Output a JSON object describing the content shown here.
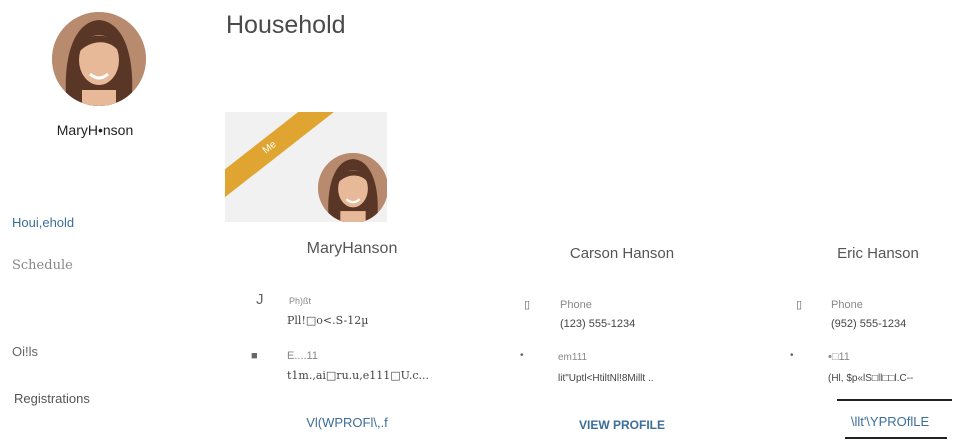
{
  "sidebar": {
    "user_name": "MaryH•nson",
    "items": [
      {
        "label": "Houi,ehold"
      },
      {
        "label": "Schedule"
      },
      {
        "label": "Oi!ls"
      },
      {
        "label": "Registrations"
      }
    ]
  },
  "main": {
    "title": "Household",
    "me_ribbon": "Me",
    "members": [
      {
        "name": "MaryHanson",
        "phone_label": "Ph)ßt",
        "phone_value": "Pll!□o<.S-12µ",
        "email_label": "E....11",
        "email_value": "t1m.,ai□ru.u,e111□U.c...",
        "view_profile": "Vl(WPROFl\\,.f"
      },
      {
        "name": "Carson Hanson",
        "phone_label": "Phone",
        "phone_value": "(123) 555-1234",
        "email_label": "em111",
        "email_value": "lit\"Uptl<HtiltNl!8Millt  ..",
        "view_profile": "VIEW PROFILE"
      },
      {
        "name": "Eric Hanson",
        "phone_label": "Phone",
        "phone_value": "(952) 555-1234",
        "email_label": "•□11",
        "email_value": "(Hl,  $p«lS□ll□□l.C--",
        "view_profile": "\\llt'\\YPROflLE"
      }
    ]
  },
  "colors": {
    "accent": "#3c6e9a",
    "ribbon": "#e0a530"
  }
}
